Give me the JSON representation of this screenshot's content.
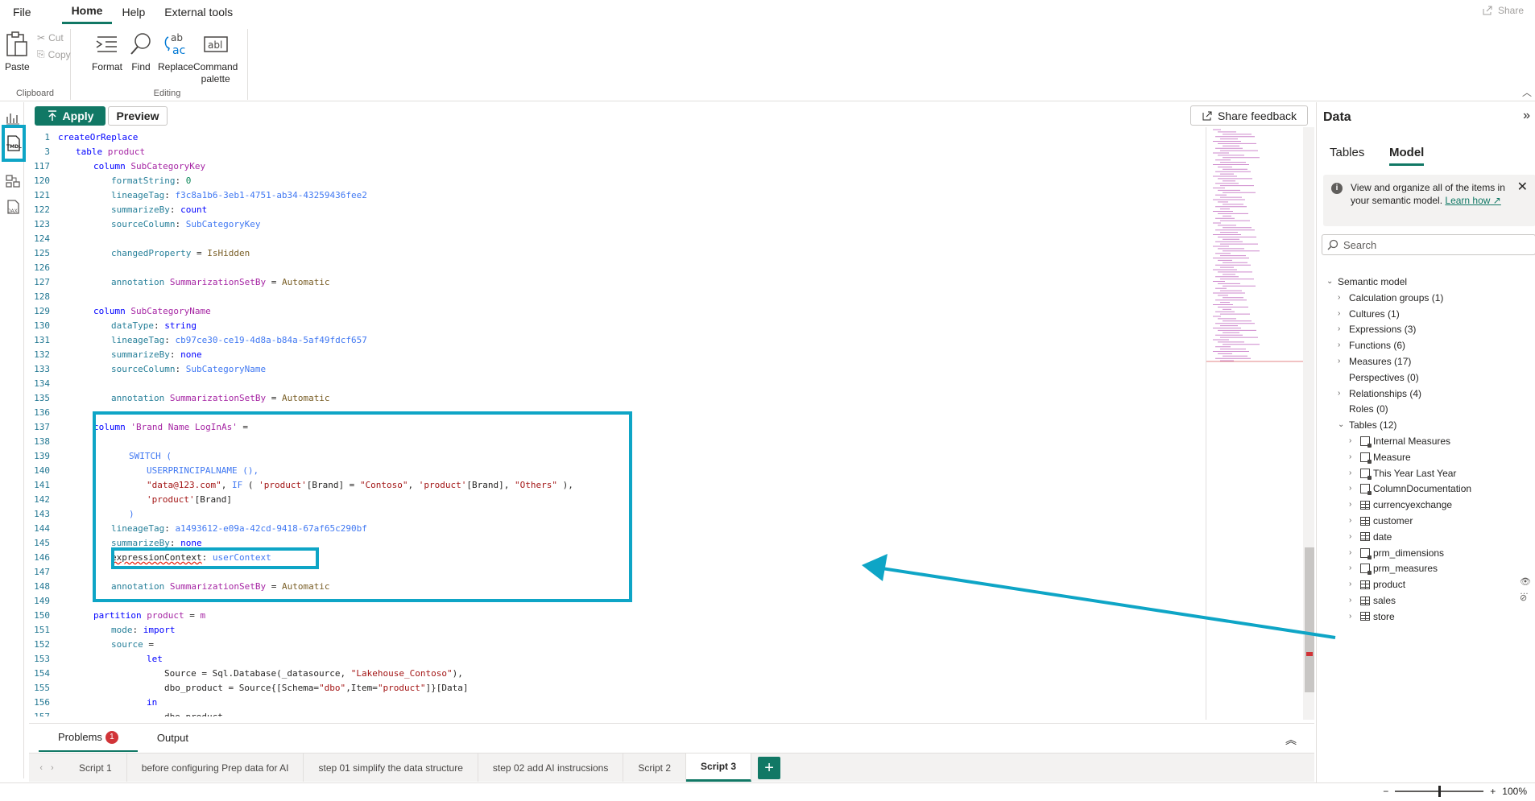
{
  "menu": {
    "items": [
      "File",
      "Home",
      "Help",
      "External tools"
    ],
    "active": "Home",
    "share": "Share"
  },
  "ribbon": {
    "clipboard": {
      "label": "Clipboard",
      "paste": "Paste",
      "cut": "Cut",
      "copy": "Copy"
    },
    "editing": {
      "label": "Editing",
      "format": "Format",
      "find": "Find",
      "replace": "Replace",
      "command_palette_line1": "Command",
      "command_palette_line2": "palette"
    }
  },
  "toolbar": {
    "apply": "Apply",
    "preview": "Preview",
    "share_feedback": "Share feedback"
  },
  "editor": {
    "lines": [
      {
        "n": "1",
        "t": [
          [
            "createOrReplace",
            "kw"
          ]
        ],
        "indent": 0
      },
      {
        "n": "3",
        "t": [
          [
            "table ",
            "kw"
          ],
          [
            "product",
            "id"
          ]
        ],
        "indent": 1
      },
      {
        "n": "117",
        "t": [
          [
            "column ",
            "kw"
          ],
          [
            "SubCategoryKey",
            "id"
          ]
        ],
        "indent": 2
      },
      {
        "n": "120",
        "t": [
          [
            "formatString",
            "pr"
          ],
          [
            ": ",
            "df"
          ],
          [
            "0",
            "gd"
          ]
        ],
        "indent": 3
      },
      {
        "n": "121",
        "t": [
          [
            "lineageTag",
            "pr"
          ],
          [
            ": ",
            "df"
          ],
          [
            "f3c8a1b6-3eb1-4751-ab34-43259436fee2",
            "mc"
          ]
        ],
        "indent": 3
      },
      {
        "n": "122",
        "t": [
          [
            "summarizeBy",
            "pr"
          ],
          [
            ": ",
            "df"
          ],
          [
            "count",
            "kw"
          ]
        ],
        "indent": 3
      },
      {
        "n": "123",
        "t": [
          [
            "sourceColumn",
            "pr"
          ],
          [
            ": ",
            "df"
          ],
          [
            "SubCategoryKey",
            "mc"
          ]
        ],
        "indent": 3
      },
      {
        "n": "124",
        "t": [],
        "indent": 0
      },
      {
        "n": "125",
        "t": [
          [
            "changedProperty",
            "pr"
          ],
          [
            " = ",
            "df"
          ],
          [
            "IsHidden",
            "val"
          ]
        ],
        "indent": 3
      },
      {
        "n": "126",
        "t": [],
        "indent": 0
      },
      {
        "n": "127",
        "t": [
          [
            "annotation ",
            "pr"
          ],
          [
            "SummarizationSetBy",
            "id"
          ],
          [
            " = ",
            "df"
          ],
          [
            "Automatic",
            "val"
          ]
        ],
        "indent": 3
      },
      {
        "n": "128",
        "t": [],
        "indent": 0
      },
      {
        "n": "129",
        "t": [
          [
            "column ",
            "kw"
          ],
          [
            "SubCategoryName",
            "id"
          ]
        ],
        "indent": 2
      },
      {
        "n": "130",
        "t": [
          [
            "dataType",
            "pr"
          ],
          [
            ": ",
            "df"
          ],
          [
            "string",
            "kw"
          ]
        ],
        "indent": 3
      },
      {
        "n": "131",
        "t": [
          [
            "lineageTag",
            "pr"
          ],
          [
            ": ",
            "df"
          ],
          [
            "cb97ce30-ce19-4d8a-b84a-5af49fdcf657",
            "mc"
          ]
        ],
        "indent": 3
      },
      {
        "n": "132",
        "t": [
          [
            "summarizeBy",
            "pr"
          ],
          [
            ": ",
            "df"
          ],
          [
            "none",
            "kw"
          ]
        ],
        "indent": 3
      },
      {
        "n": "133",
        "t": [
          [
            "sourceColumn",
            "pr"
          ],
          [
            ": ",
            "df"
          ],
          [
            "SubCategoryName",
            "mc"
          ]
        ],
        "indent": 3
      },
      {
        "n": "134",
        "t": [],
        "indent": 0
      },
      {
        "n": "135",
        "t": [
          [
            "annotation ",
            "pr"
          ],
          [
            "SummarizationSetBy",
            "id"
          ],
          [
            " = ",
            "df"
          ],
          [
            "Automatic",
            "val"
          ]
        ],
        "indent": 3
      },
      {
        "n": "136",
        "t": [],
        "indent": 0
      },
      {
        "n": "137",
        "t": [
          [
            "column ",
            "kw"
          ],
          [
            "'Brand Name LogInAs'",
            "id"
          ],
          [
            " =",
            "df"
          ]
        ],
        "indent": 2
      },
      {
        "n": "138",
        "t": [],
        "indent": 0
      },
      {
        "n": "139",
        "t": [
          [
            "SWITCH",
            "mc"
          ],
          [
            " (",
            "mc"
          ]
        ],
        "indent": 4
      },
      {
        "n": "140",
        "t": [
          [
            "USERPRINCIPALNAME",
            "mc"
          ],
          [
            " (),",
            "mc"
          ]
        ],
        "indent": 5
      },
      {
        "n": "141",
        "t": [
          [
            "\"data@123.com\"",
            "st"
          ],
          [
            ", ",
            "df"
          ],
          [
            "IF",
            "mc"
          ],
          [
            " ( ",
            "df"
          ],
          [
            "'product'",
            "st"
          ],
          [
            "[Brand]",
            "df"
          ],
          [
            " = ",
            "df"
          ],
          [
            "\"Contoso\"",
            "st"
          ],
          [
            ", ",
            "df"
          ],
          [
            "'product'",
            "st"
          ],
          [
            "[Brand]",
            "df"
          ],
          [
            ", ",
            "df"
          ],
          [
            "\"Others\"",
            "st"
          ],
          [
            " ),",
            "df"
          ]
        ],
        "indent": 5
      },
      {
        "n": "142",
        "t": [
          [
            "'product'",
            "st"
          ],
          [
            "[Brand]",
            "df"
          ]
        ],
        "indent": 5
      },
      {
        "n": "143",
        "t": [
          [
            ")",
            "mc"
          ]
        ],
        "indent": 4
      },
      {
        "n": "144",
        "t": [
          [
            "lineageTag",
            "pr"
          ],
          [
            ": ",
            "df"
          ],
          [
            "a1493612-e09a-42cd-9418-67af65c290bf",
            "mc"
          ]
        ],
        "indent": 3
      },
      {
        "n": "145",
        "t": [
          [
            "summarizeBy",
            "pr"
          ],
          [
            ": ",
            "df"
          ],
          [
            "none",
            "kw"
          ]
        ],
        "indent": 3
      },
      {
        "n": "146",
        "t": [
          [
            "expressionContext",
            "sq"
          ],
          [
            ": ",
            "df"
          ],
          [
            "userContext",
            "mc"
          ]
        ],
        "indent": 3
      },
      {
        "n": "147",
        "t": [],
        "indent": 0
      },
      {
        "n": "148",
        "t": [
          [
            "annotation ",
            "pr"
          ],
          [
            "SummarizationSetBy",
            "id"
          ],
          [
            " = ",
            "df"
          ],
          [
            "Automatic",
            "val"
          ]
        ],
        "indent": 3
      },
      {
        "n": "149",
        "t": [],
        "indent": 0
      },
      {
        "n": "150",
        "t": [
          [
            "partition ",
            "kw"
          ],
          [
            "product",
            "id"
          ],
          [
            " = ",
            "df"
          ],
          [
            "m",
            "id"
          ]
        ],
        "indent": 2
      },
      {
        "n": "151",
        "t": [
          [
            "mode",
            "pr"
          ],
          [
            ": ",
            "df"
          ],
          [
            "import",
            "kw"
          ]
        ],
        "indent": 3
      },
      {
        "n": "152",
        "t": [
          [
            "source",
            "pr"
          ],
          [
            " =",
            "df"
          ]
        ],
        "indent": 3
      },
      {
        "n": "153",
        "t": [
          [
            "let",
            "kw"
          ]
        ],
        "indent": 5
      },
      {
        "n": "154",
        "t": [
          [
            "Source = Sql.Database(_datasource, ",
            "df"
          ],
          [
            "\"Lakehouse_Contoso\"",
            "st"
          ],
          [
            "),",
            "df"
          ]
        ],
        "indent": 6
      },
      {
        "n": "155",
        "t": [
          [
            "dbo_product = Source{[Schema=",
            "df"
          ],
          [
            "\"dbo\"",
            "st"
          ],
          [
            ",Item=",
            "df"
          ],
          [
            "\"product\"",
            "st"
          ],
          [
            "]}[Data]",
            "df"
          ]
        ],
        "indent": 6
      },
      {
        "n": "156",
        "t": [
          [
            "in",
            "kw"
          ]
        ],
        "indent": 5
      },
      {
        "n": "157",
        "t": [
          [
            "dbo_product",
            "df"
          ]
        ],
        "indent": 6
      }
    ]
  },
  "bottom": {
    "problems": "Problems",
    "problems_count": "1",
    "output": "Output"
  },
  "scripts": {
    "tabs": [
      "Script 1",
      "before configuring Prep data for AI",
      "step 01 simplify the data structure",
      "step 02 add AI instrucsions",
      "Script 2",
      "Script 3"
    ],
    "active": "Script 3",
    "add": "+"
  },
  "status": {
    "zoom": "100%",
    "zoom_level": 0.5
  },
  "data_pane": {
    "title": "Data",
    "tabs": [
      "Tables",
      "Model"
    ],
    "active_tab": "Model",
    "info_text": "View and organize all of the items in your semantic model.",
    "learn_how": "Learn how",
    "search_placeholder": "Search",
    "root": "Semantic model",
    "groups": [
      "Calculation groups (1)",
      "Cultures (1)",
      "Expressions (3)",
      "Functions (6)",
      "Measures (17)",
      "Perspectives (0)",
      "Relationships (4)",
      "Roles (0)",
      "Tables (12)"
    ],
    "tables": [
      {
        "name": "Internal Measures",
        "icon": "calc-table-icon"
      },
      {
        "name": "Measure",
        "icon": "calc-table-icon"
      },
      {
        "name": "This Year Last Year",
        "icon": "calc-table-icon"
      },
      {
        "name": "ColumnDocumentation",
        "icon": "calc-table-icon"
      },
      {
        "name": "currencyexchange",
        "icon": "table-icon"
      },
      {
        "name": "customer",
        "icon": "table-icon"
      },
      {
        "name": "date",
        "icon": "table-icon"
      },
      {
        "name": "prm_dimensions",
        "icon": "calc-table-icon"
      },
      {
        "name": "prm_measures",
        "icon": "calc-table-icon"
      },
      {
        "name": "product",
        "icon": "table-icon"
      },
      {
        "name": "sales",
        "icon": "table-icon"
      },
      {
        "name": "store",
        "icon": "table-icon"
      }
    ]
  },
  "colors": {
    "accent": "#117865",
    "highlight": "#0ea5c6",
    "error": "#d13438"
  }
}
